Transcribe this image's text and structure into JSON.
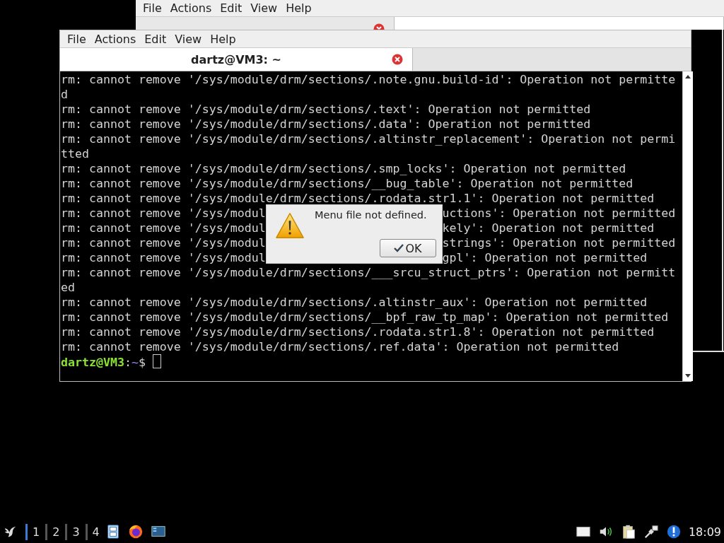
{
  "background_window": {
    "menu": [
      "File",
      "Actions",
      "Edit",
      "View",
      "Help"
    ],
    "tabs": [
      {
        "selected": false,
        "closable": true
      },
      {
        "selected": true,
        "closable": false
      }
    ]
  },
  "terminal_window": {
    "menu": [
      "File",
      "Actions",
      "Edit",
      "View",
      "Help"
    ],
    "tabs": [
      {
        "title": "dartz@VM3: ~",
        "selected": true,
        "closable": true
      }
    ],
    "lines": [
      {
        "text": "rm: cannot remove '/sys/module/drm/sections/.note.gnu.build-id': Operation not permitte"
      },
      {
        "text": "d"
      },
      {
        "text": "rm: cannot remove '/sys/module/drm/sections/.text': Operation not permitted"
      },
      {
        "text": "rm: cannot remove '/sys/module/drm/sections/.data': Operation not permitted"
      },
      {
        "text": "rm: cannot remove '/sys/module/drm/sections/.altinstr_replacement': Operation not permi"
      },
      {
        "text": "tted"
      },
      {
        "text": "rm: cannot remove '/sys/module/drm/sections/.smp_locks': Operation not permitted"
      },
      {
        "text": "rm: cannot remove '/sys/module/drm/sections/__bug_table': Operation not permitted"
      },
      {
        "text": "rm: cannot remove '/sys/module/drm/sections/.rodata.str1.1': Operation not permitted"
      },
      {
        "text": "rm: cannot remove '/sys/modul",
        "after": "uctions': Operation not permitted"
      },
      {
        "text": "rm: cannot remove '/sys/modul",
        "after": "kely': Operation not permitted"
      },
      {
        "text": "rm: cannot remove '/sys/modul",
        "after": "strings': Operation not permitted"
      },
      {
        "text": "rm: cannot remove '/sys/modul",
        "after": "gpl': Operation not permitted"
      },
      {
        "text": "rm: cannot remove '/sys/module/drm/sections/___srcu_struct_ptrs': Operation not permitt"
      },
      {
        "text": "ed"
      },
      {
        "text": "rm: cannot remove '/sys/module/drm/sections/.altinstr_aux': Operation not permitted"
      },
      {
        "text": "rm: cannot remove '/sys/module/drm/sections/__bpf_raw_tp_map': Operation not permitted"
      },
      {
        "text": "rm: cannot remove '/sys/module/drm/sections/.rodata.str1.8': Operation not permitted"
      },
      {
        "text": "rm: cannot remove '/sys/module/drm/sections/.ref.data': Operation not permitted"
      }
    ],
    "prompt": [
      {
        "kind": "user",
        "text": "dartz@VM3"
      },
      {
        "kind": "sep",
        "text": ":"
      },
      {
        "kind": "path",
        "text": "~"
      },
      {
        "kind": "symbol",
        "text": "$"
      }
    ]
  },
  "dialog": {
    "message": "Menu file not defined.",
    "button": "OK"
  },
  "taskbar": {
    "workspaces": [
      {
        "label": "1",
        "selected": true
      },
      {
        "label": "2",
        "selected": false
      },
      {
        "label": "3",
        "selected": false
      },
      {
        "label": "4",
        "selected": false
      }
    ],
    "launchers": [
      {
        "kind": "files"
      },
      {
        "kind": "browser"
      },
      {
        "kind": "desktop"
      }
    ],
    "tray": [
      {
        "kind": "drive"
      },
      {
        "kind": "volume"
      },
      {
        "kind": "clipboard"
      },
      {
        "kind": "network"
      },
      {
        "kind": "info"
      }
    ],
    "clock": "18:09"
  }
}
